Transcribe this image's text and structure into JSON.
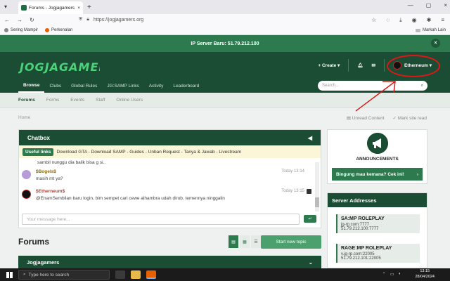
{
  "browser": {
    "tab_title": "Forums - Jogjagamers Commu",
    "tab_close": "×",
    "new_tab": "+",
    "url": "https://jogjagamers.org",
    "bookmarks": [
      "Sering Mampir",
      "Perkenalan"
    ],
    "bookmarks_other": "Markah Lain",
    "window_controls": [
      "—",
      "▢",
      "×"
    ]
  },
  "site": {
    "notice": "IP Server Baru: 51.79.212.100",
    "notice_close": "×",
    "logo_text": "JOGJAGAMERS",
    "create_label": "+ Create ▾",
    "username": "Etherneum ▾",
    "main_nav": [
      "Browse",
      "Clubs",
      "Global Rules",
      "JG:SAMP Links",
      "Activity",
      "Leaderboard"
    ],
    "search_placeholder": "Search...",
    "sub_nav": [
      "Forums",
      "Forms",
      "Events",
      "Staff",
      "Online Users"
    ],
    "breadcrumb": "Home",
    "unread": "Unread Content",
    "mark_read": "Mark site read",
    "chatbox": {
      "title": "Chatbox",
      "collapse": "◀",
      "useful_links": "Useful links",
      "links_text": "Download GTA - Download SAMP - Guides - Unban Request - Tanya & Jawab - Livestream",
      "first_line": "sambil nunggu dia balik bisa g si..",
      "messages": [
        {
          "name": "$Bogels$",
          "text": "masih mt ya?",
          "time": "Today 13:14"
        },
        {
          "name": "$Etherneum$",
          "text": "@EnamSembilan baru login, bim sempet cari cewe alhambra udah dirob, temennya ninggalin",
          "time": "Today 13:15"
        }
      ],
      "input_placeholder": "Your message here...",
      "send": "↵"
    },
    "forums_title": "Forums",
    "start_topic": "Start new topic",
    "category": "Jogjagamers",
    "announcements": {
      "label": "ANNOUNCEMENTS",
      "button": "Bingung mau kemana? Cek ini!",
      "arrow": "›"
    },
    "servers": {
      "title": "Server Addresses",
      "list": [
        {
          "name": "SA:MP ROLEPLAY",
          "lines": [
            "jg-rp.com:7777",
            "51.79.212.100:7777"
          ]
        },
        {
          "name": "RAGE:MP ROLEPLAY",
          "lines": [
            "v.jg-rp.com:22005",
            "51.79.212.101:22005"
          ]
        }
      ]
    }
  },
  "taskbar": {
    "search": "Type here to search",
    "time": "13:15",
    "date": "28/04/2024"
  },
  "colors": {
    "brand_dark": "#1a4d33",
    "brand": "#2d7a4f",
    "annotation_red": "#e01616"
  }
}
